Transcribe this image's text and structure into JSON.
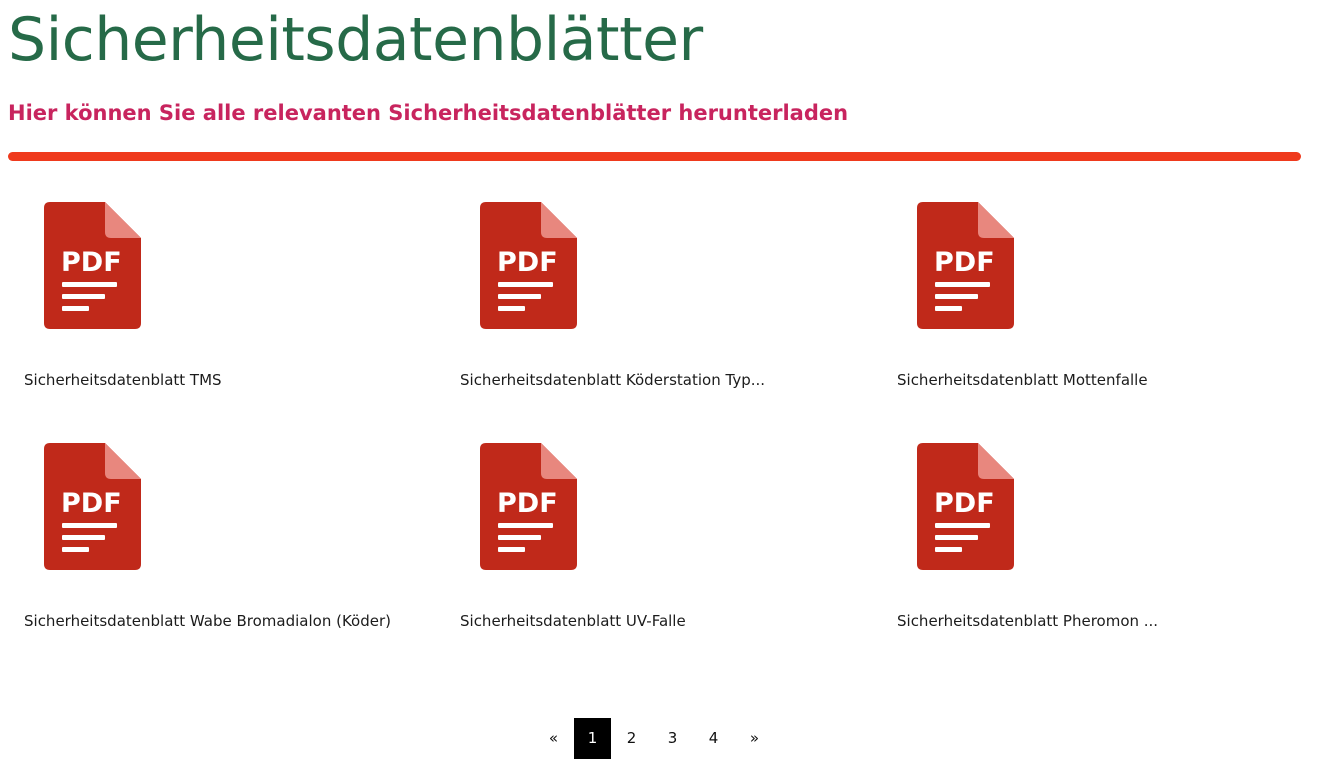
{
  "header": {
    "title": "Sicherheitsdatenblätter",
    "subtitle": "Hier können Sie alle relevanten Sicherheitsdatenblätter herunterladen"
  },
  "colors": {
    "title": "#266a48",
    "subtitle": "#c8245e",
    "divider": "#ef3a1d",
    "pdf_icon": "#c0291a",
    "pdf_fold": "#e8877e"
  },
  "documents": [
    {
      "icon": "pdf-file-icon",
      "icon_label": "PDF",
      "title": "Sicherheitsdatenblatt TMS"
    },
    {
      "icon": "pdf-file-icon",
      "icon_label": "PDF",
      "title": "Sicherheitsdatenblatt Köderstation Typ..."
    },
    {
      "icon": "pdf-file-icon",
      "icon_label": "PDF",
      "title": "Sicherheitsdatenblatt Mottenfalle"
    },
    {
      "icon": "pdf-file-icon",
      "icon_label": "PDF",
      "title": "Sicherheitsdatenblatt Wabe Bromadialon (Köder)"
    },
    {
      "icon": "pdf-file-icon",
      "icon_label": "PDF",
      "title": "Sicherheitsdatenblatt UV-Falle"
    },
    {
      "icon": "pdf-file-icon",
      "icon_label": "PDF",
      "title": "Sicherheitsdatenblatt Pheromon ..."
    }
  ],
  "pagination": {
    "prev": "«",
    "pages": [
      "1",
      "2",
      "3",
      "4"
    ],
    "current": "1",
    "next": "»"
  }
}
